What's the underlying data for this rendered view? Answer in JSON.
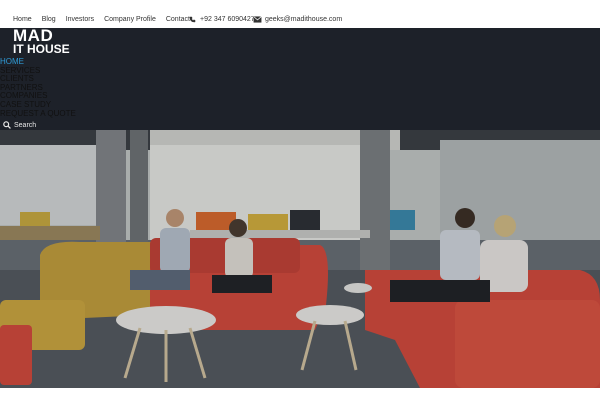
{
  "topbar": {
    "links": [
      "Home",
      "Blog",
      "Investors",
      "Company Profile",
      "Contact"
    ],
    "phone": "+92 347 6090427",
    "email": "geeks@madithouse.com"
  },
  "logo": {
    "line1": "MAD",
    "line2": "IT HOUSE"
  },
  "nav": {
    "items": [
      "Home",
      "Services",
      "Clients",
      "Partners",
      "Companies",
      "Case Study",
      "Request a Quote"
    ],
    "active": "Home"
  },
  "search": {
    "label": "Search"
  },
  "colors": {
    "header_bg": "#1d2129",
    "accent": "#2f9bd6",
    "sofa": "#d9493a",
    "mustard": "#c9a13a"
  }
}
